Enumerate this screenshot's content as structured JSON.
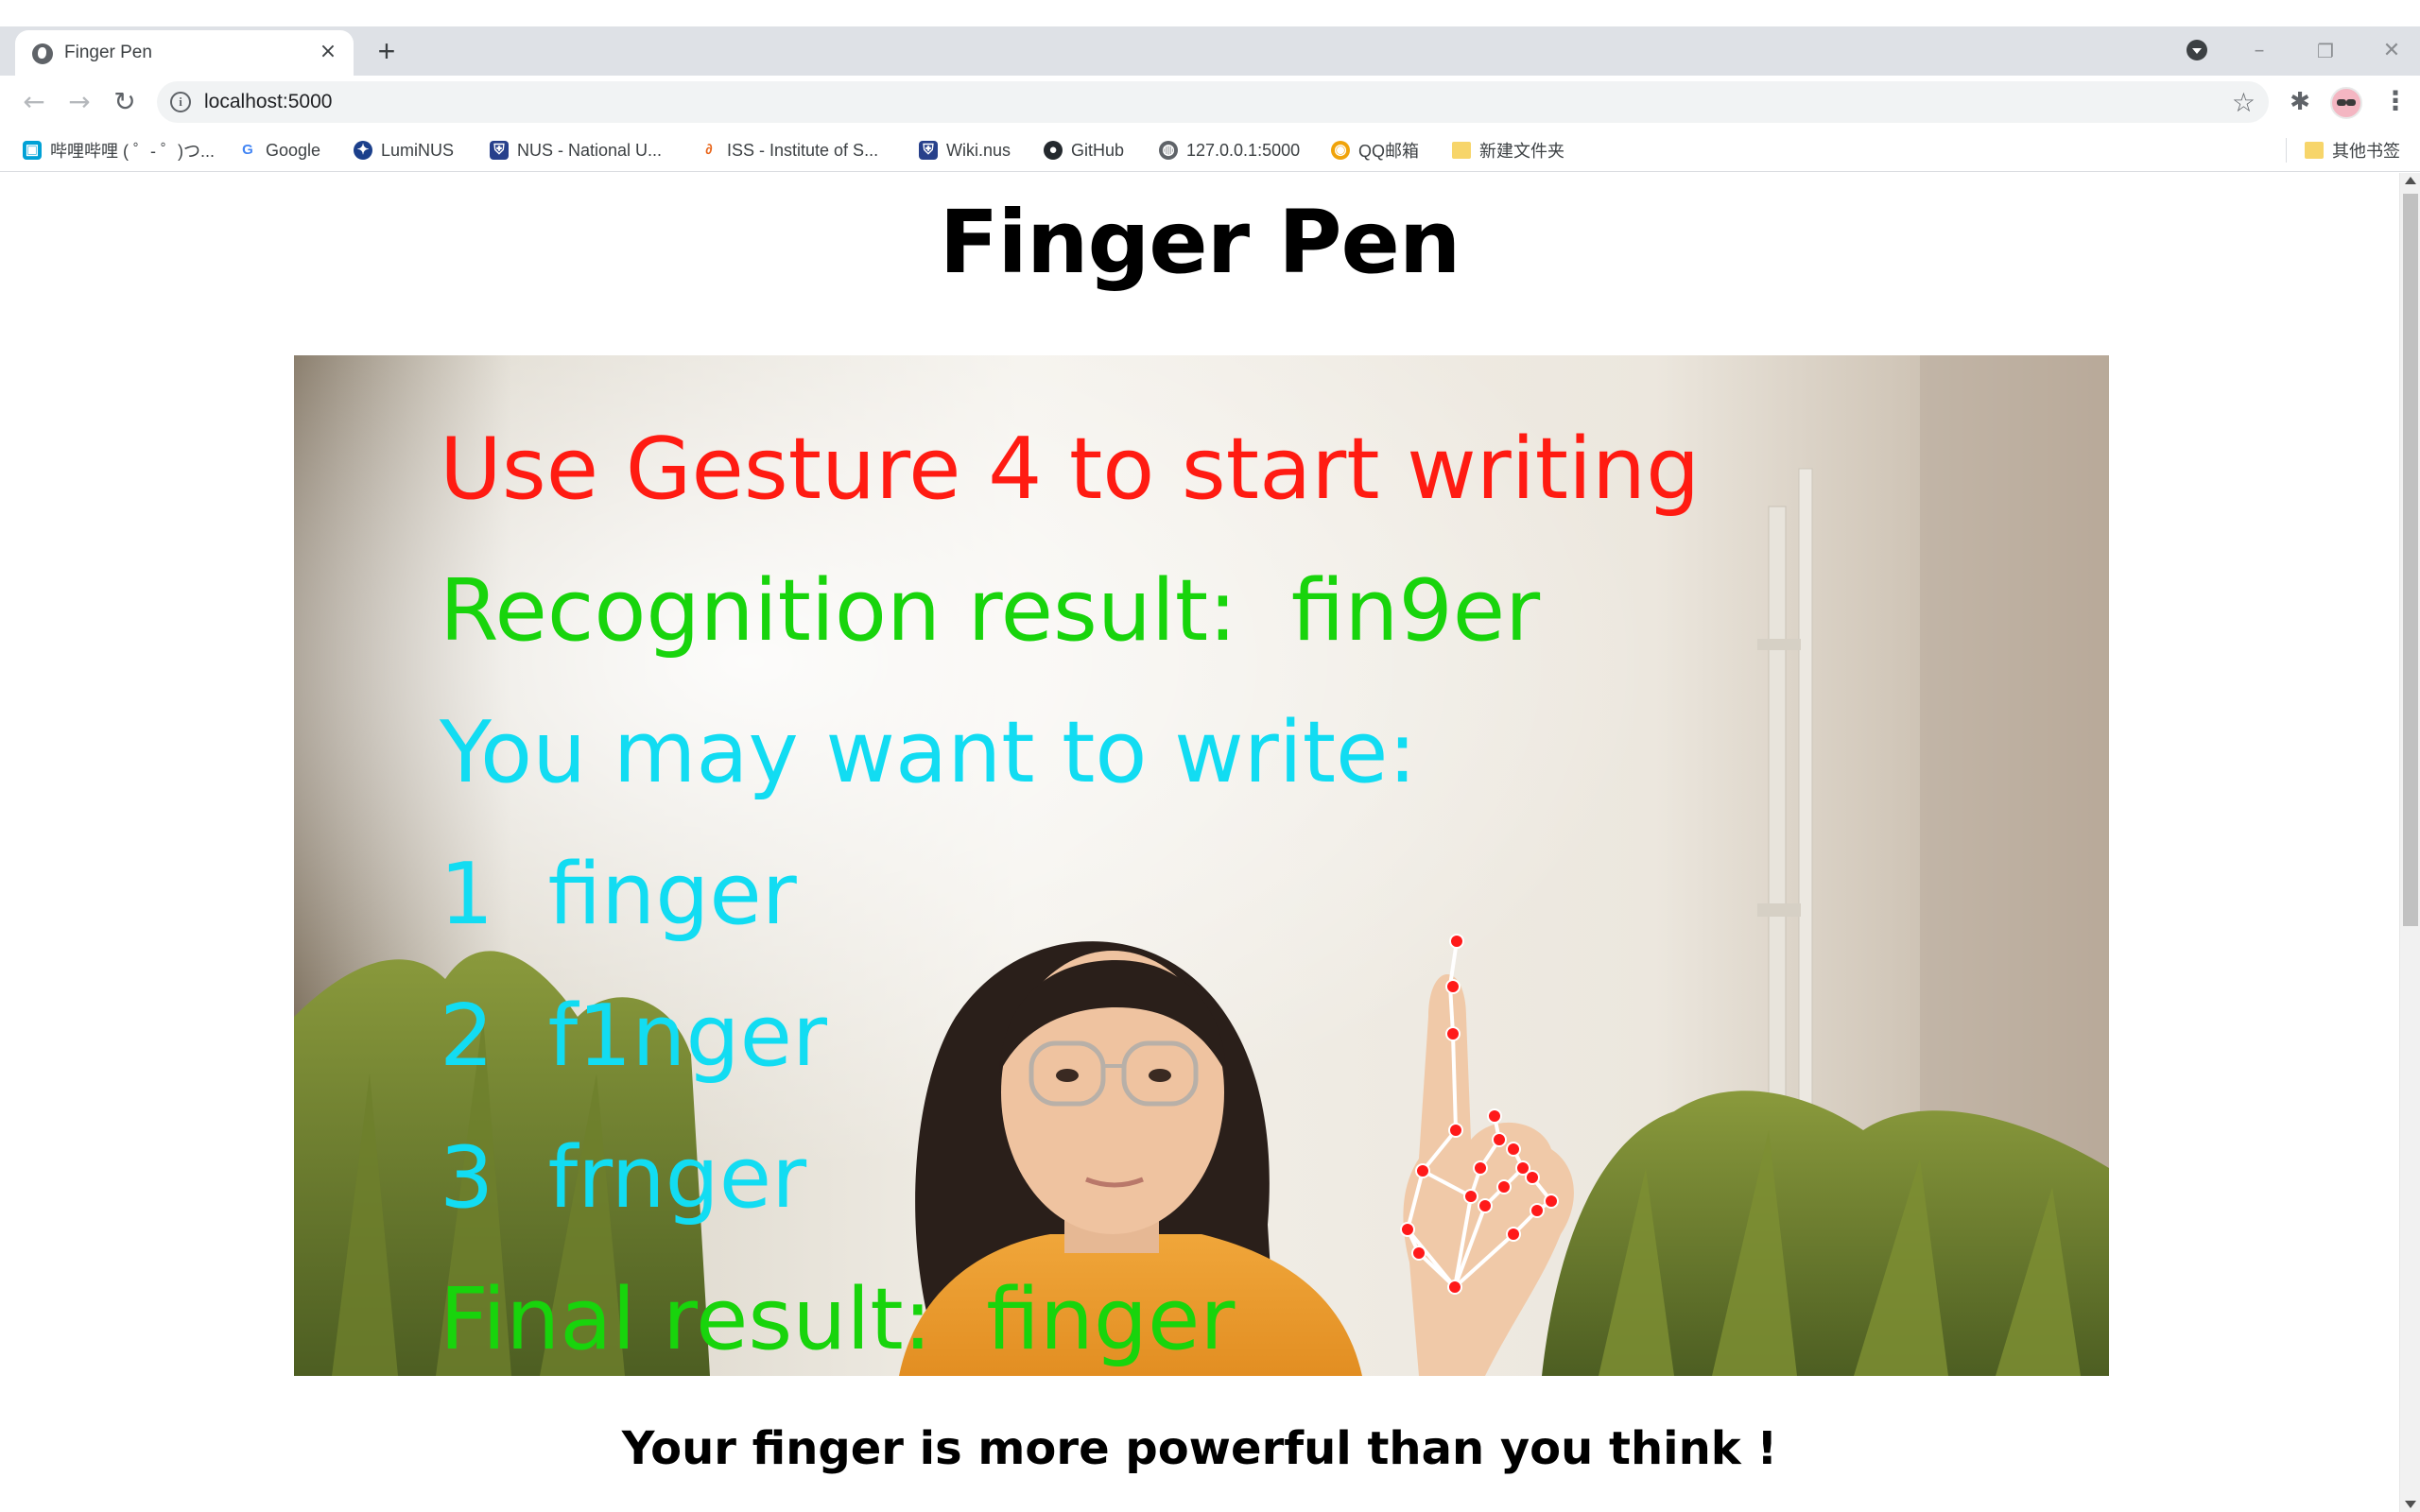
{
  "browser": {
    "tab": {
      "title": "Finger Pen",
      "close_icon": "×"
    },
    "new_tab_icon": "+",
    "window_controls": {
      "minimize": "–",
      "restore": "❐",
      "close": "✕"
    },
    "nav": {
      "back": "←",
      "forward": "→",
      "reload": "↻"
    },
    "url": "localhost:5000",
    "bookmarks": [
      {
        "label": "哔哩哔哩 ( ゜- ゜)つ...",
        "icon": "bilibili-icon",
        "color": "#00a1d6"
      },
      {
        "label": "Google",
        "icon": "google-icon",
        "color": "#4285f4"
      },
      {
        "label": "LumiNUS",
        "icon": "luminus-icon",
        "color": "#1b3f8b"
      },
      {
        "label": "NUS - National U...",
        "icon": "nus-crest-icon",
        "color": "#27408b"
      },
      {
        "label": "ISS - Institute of S...",
        "icon": "iss-icon",
        "color": "#e8651a"
      },
      {
        "label": "Wiki.nus",
        "icon": "nus-crest-icon",
        "color": "#27408b"
      },
      {
        "label": "GitHub",
        "icon": "github-icon",
        "color": "#24292e"
      },
      {
        "label": "127.0.0.1:5000",
        "icon": "globe-icon",
        "color": "#5f6368"
      },
      {
        "label": "QQ邮箱",
        "icon": "qqmail-icon",
        "color": "#f0a30a"
      },
      {
        "label": "新建文件夹",
        "icon": "folder-icon",
        "color": "#f7d56a"
      }
    ],
    "other_bookmarks": "其他书签"
  },
  "page": {
    "title": "Finger Pen",
    "overlay": {
      "instruction": "Use Gesture 4 to start writing",
      "recognition": "Recognition result:  fin9er",
      "suggestion_heading": "You may want to write:",
      "suggestions": [
        "1  finger",
        "2  f1nger",
        "3  frnger"
      ],
      "final": "Final result:  finger"
    },
    "tagline": "Your finger is more powerful than you think !"
  },
  "colors": {
    "overlay_red": "#ff1b12",
    "overlay_green": "#18d40c",
    "overlay_cyan": "#12dcf2",
    "landmark_dot": "#ff1a1a"
  }
}
